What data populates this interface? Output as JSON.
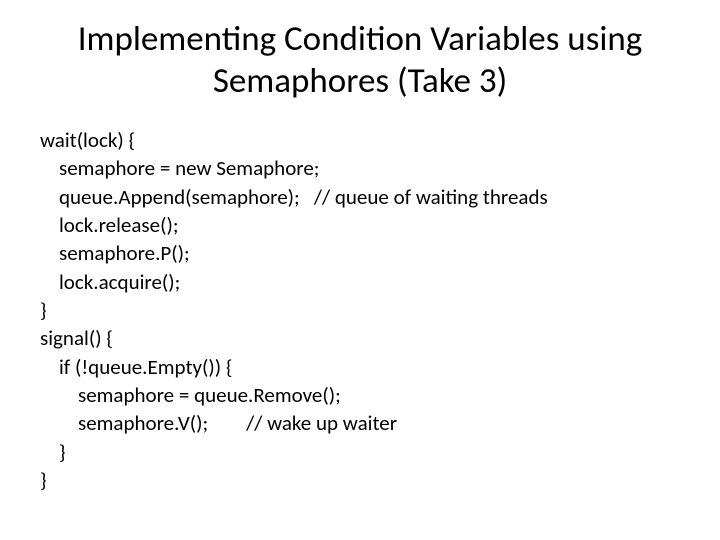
{
  "title": "Implementing Condition Variables using Semaphores (Take 3)",
  "code": "wait(lock) {\n    semaphore = new Semaphore;\n    queue.Append(semaphore);   // queue of waiting threads\n    lock.release();\n    semaphore.P();\n    lock.acquire();\n}\nsignal() {\n    if (!queue.Empty()) {\n        semaphore = queue.Remove();\n        semaphore.V();        // wake up waiter\n    }\n}"
}
